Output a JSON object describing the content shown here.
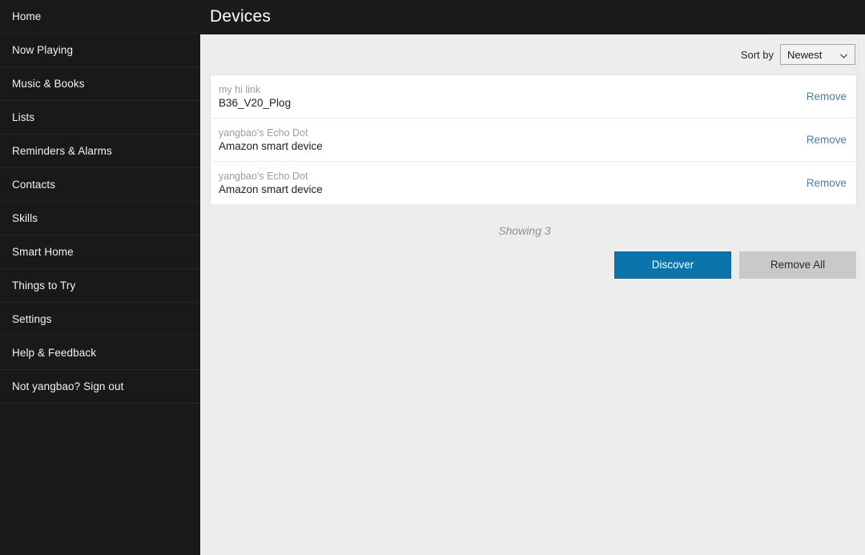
{
  "sidebar": {
    "items": [
      {
        "label": "Home"
      },
      {
        "label": "Now Playing"
      },
      {
        "label": "Music & Books"
      },
      {
        "label": "Lists"
      },
      {
        "label": "Reminders & Alarms"
      },
      {
        "label": "Contacts"
      },
      {
        "label": "Skills"
      },
      {
        "label": "Smart Home"
      },
      {
        "label": "Things to Try"
      },
      {
        "label": "Settings"
      },
      {
        "label": "Help & Feedback"
      },
      {
        "label": "Not yangbao? Sign out"
      }
    ]
  },
  "header": {
    "title": "Devices"
  },
  "sort": {
    "label": "Sort by",
    "selected": "Newest",
    "options": [
      "Newest"
    ],
    "chevron_icon": "chevron-down-icon"
  },
  "devices": {
    "rows": [
      {
        "name": "my hi link",
        "subtitle": "B36_V20_Plog",
        "action_label": "Remove"
      },
      {
        "name": "yangbao's Echo Dot",
        "subtitle": "Amazon smart device",
        "action_label": "Remove"
      },
      {
        "name": "yangbao's Echo Dot",
        "subtitle": "Amazon smart device",
        "action_label": "Remove"
      }
    ],
    "showing_text": "Showing 3",
    "count": 3
  },
  "actions": {
    "discover_label": "Discover",
    "remove_all_label": "Remove All"
  },
  "colors": {
    "sidebar_bg": "#191919",
    "topbar_bg": "#1b1b1b",
    "content_bg": "#ededed",
    "card_bg": "#ffffff",
    "accent_blue": "#0a74ab",
    "link_blue": "#4b7f9e",
    "button_gray": "#c9c9c9",
    "muted_text": "#9c9c9c"
  }
}
